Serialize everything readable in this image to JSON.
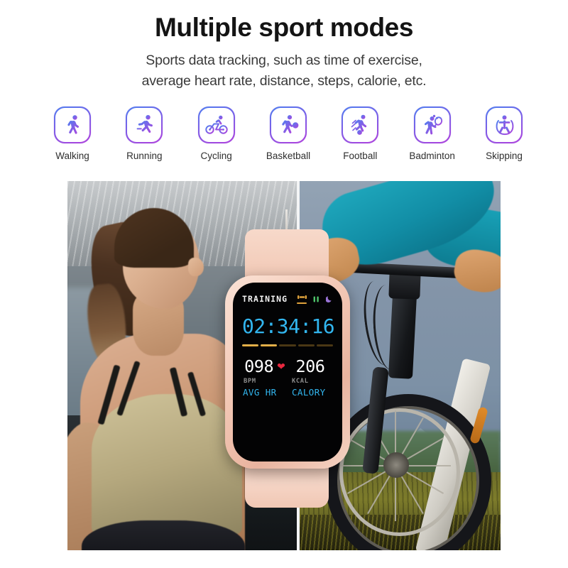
{
  "header": {
    "headline": "Multiple sport modes",
    "subline_1": "Sports data tracking, such as time of exercise,",
    "subline_2": "average heart rate, distance, steps, calorie, etc."
  },
  "sport_modes": [
    {
      "label": "Walking",
      "icon": "walking-icon"
    },
    {
      "label": "Running",
      "icon": "running-icon"
    },
    {
      "label": "Cycling",
      "icon": "cycling-icon"
    },
    {
      "label": "Basketball",
      "icon": "basketball-icon"
    },
    {
      "label": "Football",
      "icon": "football-icon"
    },
    {
      "label": "Badminton",
      "icon": "badminton-icon"
    },
    {
      "label": "Skipping",
      "icon": "skipping-icon"
    }
  ],
  "watch_screen": {
    "title": "TRAINING",
    "status_icons": [
      {
        "name": "dumbbell-icon",
        "color": "#e0a33c",
        "active": true
      },
      {
        "name": "signal-bars-icon",
        "color": "#4ec36a",
        "active": false
      },
      {
        "name": "moon-icon",
        "color": "#9a74d8",
        "active": false
      }
    ],
    "timer": "02:34:16",
    "progress_segments": [
      true,
      true,
      false,
      false,
      false
    ],
    "stats": [
      {
        "value": "098",
        "unit": "BPM",
        "name": "AVG HR",
        "has_heart": true
      },
      {
        "value": "206",
        "unit": "KCAL",
        "name": "CALORY",
        "has_heart": false
      }
    ]
  },
  "photos": {
    "left": {
      "name": "woman-running-gym-photo",
      "alt": "Woman with ponytail in olive sports bra exercising in a gym"
    },
    "right": {
      "name": "cyclist-mountain-photo",
      "alt": "Cyclist in teal jacket holding mountain bike handlebars on a mountain ridge"
    },
    "product": {
      "name": "smartwatch-product",
      "alt": "Pink rose-gold smartwatch showing training screen"
    }
  },
  "colors": {
    "accent_cyan": "#32b6ef",
    "accent_gold": "#e0a33c",
    "heart_red": "#e8283f",
    "gradient_start": "#4f7ff0",
    "gradient_end": "#b042dd",
    "watch_case": "#f3c9b7"
  }
}
